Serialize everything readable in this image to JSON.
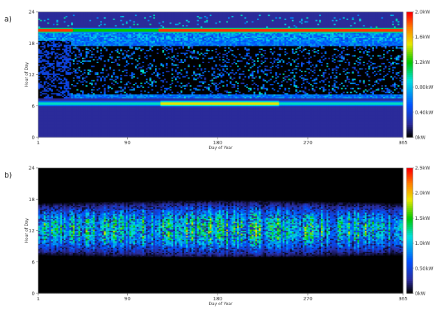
{
  "chart_data": [
    {
      "type": "heatmap",
      "panel_label": "a)",
      "xlabel": "Day of Year",
      "ylabel": "Hour of Day",
      "xlim": [
        1,
        365
      ],
      "ylim": [
        0,
        24
      ],
      "x_ticks": [
        "1",
        "90",
        "180",
        "270",
        "365"
      ],
      "y_ticks": [
        "0",
        "6",
        "12",
        "18",
        "24"
      ],
      "colorbar": {
        "min": 0,
        "max": 2.0,
        "tick_labels": [
          "0kW",
          "0.40kW",
          "0.80kW",
          "1.2kW",
          "1.6kW",
          "2.0kW"
        ]
      },
      "colors": [
        "#000000",
        "#2b2b9a",
        "#0050ff",
        "#00e0e0",
        "#00c800",
        "#e8e800",
        "#ff8000",
        "#ff0000"
      ],
      "description": "Base load ~0.2 kW; high-demand bands near 06-07 h and 20-21 h; sparse activity between 08-18 h"
    },
    {
      "type": "heatmap",
      "panel_label": "b)",
      "xlabel": "Day of Year",
      "ylabel": "Hour of Day",
      "xlim": [
        1,
        365
      ],
      "ylim": [
        0,
        24
      ],
      "x_ticks": [
        "1",
        "90",
        "180",
        "270",
        "365"
      ],
      "y_ticks": [
        "0",
        "6",
        "12",
        "18",
        "24"
      ],
      "colorbar": {
        "min": 0,
        "max": 2.5,
        "tick_labels": [
          "0kW",
          "0.50kW",
          "1.0kW",
          "1.5kW",
          "2.0kW",
          "2.5kW"
        ]
      },
      "colors": [
        "#000000",
        "#2b2b9a",
        "#0050ff",
        "#00e0e0",
        "#00c800",
        "#e8e800",
        "#ff8000",
        "#ff0000"
      ],
      "description": "Zero outside ~07-18 h; daytime generation peaking near 11-13 h"
    }
  ]
}
